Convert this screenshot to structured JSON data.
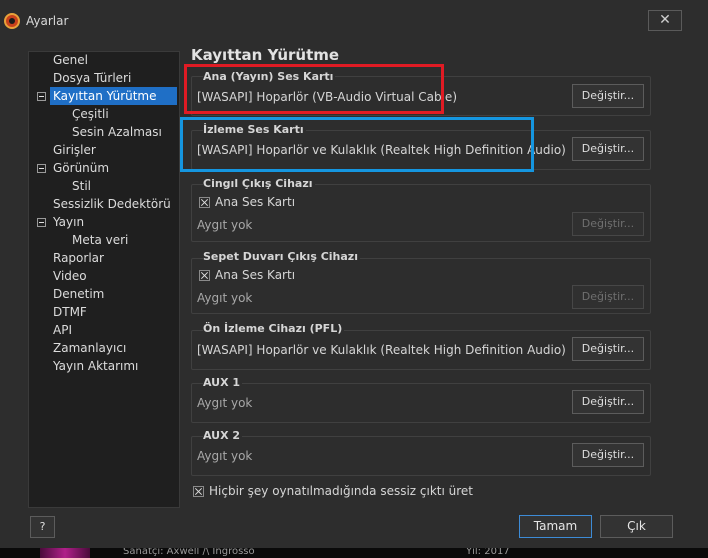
{
  "window": {
    "title": "Ayarlar",
    "close_label": "✕"
  },
  "nav": {
    "items": [
      {
        "label": "Genel"
      },
      {
        "label": "Dosya Türleri"
      },
      {
        "label": "Kayıttan Yürütme"
      },
      {
        "label": "Çeşitli"
      },
      {
        "label": "Sesin Azalması"
      },
      {
        "label": "Girişler"
      },
      {
        "label": "Görünüm"
      },
      {
        "label": "Stil"
      },
      {
        "label": "Sessizlik Dedektörü"
      },
      {
        "label": "Yayın"
      },
      {
        "label": "Meta veri"
      },
      {
        "label": "Raporlar"
      },
      {
        "label": "Video"
      },
      {
        "label": "Denetim"
      },
      {
        "label": "DTMF"
      },
      {
        "label": "API"
      },
      {
        "label": "Zamanlayıcı"
      },
      {
        "label": "Yayın Aktarımı"
      }
    ]
  },
  "page": {
    "title": "Kayıttan Yürütme",
    "groups": {
      "main": {
        "title": "Ana (Yayın) Ses Kartı",
        "value": "[WASAPI] Hoparlör (VB-Audio Virtual Cable)",
        "button": "Değiştir..."
      },
      "monitor": {
        "title": "İzleme Ses Kartı",
        "value": "[WASAPI] Hoparlör ve Kulaklık (Realtek High Definition Audio)",
        "button": "Değiştir..."
      },
      "jingle": {
        "title": "Cingıl Çıkış Cihazı",
        "checkbox_label": "Ana Ses Kartı",
        "value": "Aygıt yok",
        "button": "Değiştir..."
      },
      "sweeper": {
        "title": "Sepet Duvarı Çıkış Cihazı",
        "checkbox_label": "Ana Ses Kartı",
        "value": "Aygıt yok",
        "button": "Değiştir..."
      },
      "pfl": {
        "title": "Ön İzleme Cihazı (PFL)",
        "value": "[WASAPI] Hoparlör ve Kulaklık (Realtek High Definition Audio)",
        "button": "Değiştir..."
      },
      "aux1": {
        "title": "AUX 1",
        "value": "Aygıt yok",
        "button": "Değiştir..."
      },
      "aux2": {
        "title": "AUX 2",
        "value": "Aygıt yok",
        "button": "Değiştir..."
      }
    },
    "silence_option": "Hiçbir şey oynatılmadığında sessiz çıktı üret"
  },
  "footer": {
    "help": "?",
    "ok": "Tamam",
    "cancel": "Çık"
  },
  "background_strip": {
    "left_text": "Sanatçı: Axwell /\\ Ingrosso",
    "right_text": "Yıl: 2017"
  },
  "colors": {
    "highlight_red": "#e01b24",
    "highlight_blue": "#1596e0",
    "selection": "#1f6fc6"
  }
}
